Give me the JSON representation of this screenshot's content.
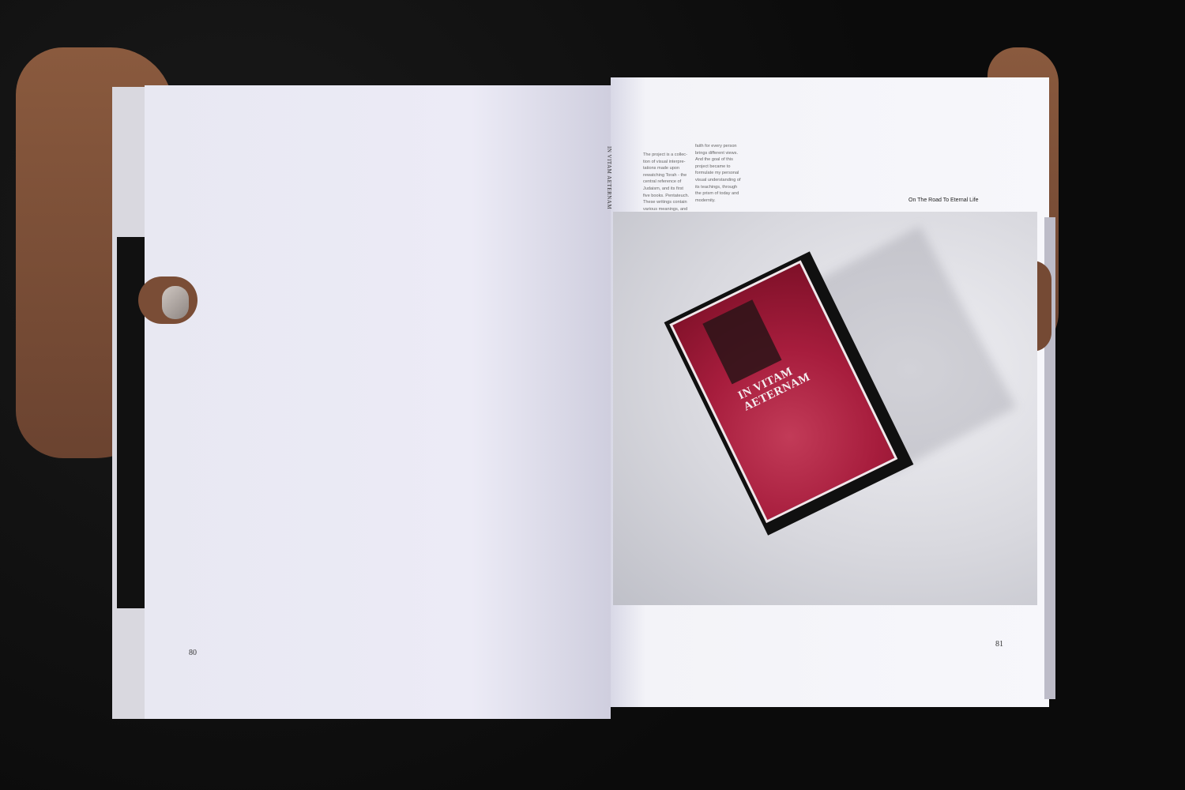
{
  "spread": {
    "left_page_number": "80",
    "right_page_number": "81",
    "spine_title": "IN VITAM AETERNAM",
    "running_head": "On The Road To Eternal Life",
    "column1": "The project is a collec-\ntion of visual interpre-\ntations made upon\nrewatching Torah - the\ncentral reference of\nJudaism, and its first\nfive books. Pentateuch.\nThese writings contain\nvarious meanings, and",
    "column2": "faith for every person\nbrings different views.\nAnd the goal of this\nproject became to\nformulate my personal\nvisual understanding of\nits teachings, through\nthe prism of today and\nmodernity."
  },
  "photo": {
    "cover_title_line1": "IN VITAM",
    "cover_title_line2": "AETERNAM"
  }
}
